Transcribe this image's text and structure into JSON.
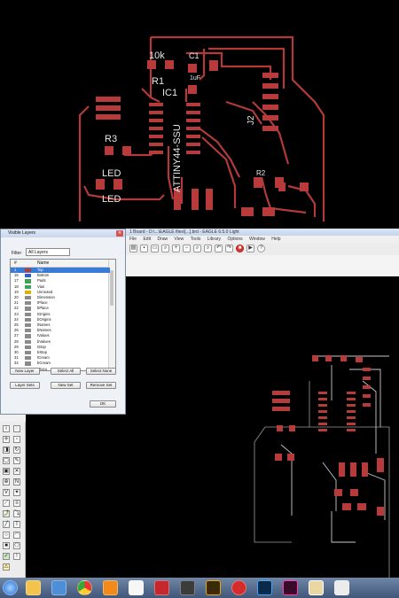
{
  "top_board": {
    "labels": {
      "r1_value": "10k",
      "r1": "R1",
      "ic1": "IC1",
      "c1": "C1",
      "c1_value": "1uF",
      "r3": "R3",
      "j2": "J2",
      "r2": "R2",
      "led_1": "LED",
      "led_2": "LED",
      "ic_part": "ATTINY44-SSU"
    },
    "colors": {
      "trace": "#b23a3a",
      "pad": "#b83b3b",
      "background": "#000000",
      "text": "#e8e8e8"
    }
  },
  "eagle_window": {
    "title": "1 Board - D:\\...\\EAGLE files\\[...].brd - EAGLE 6.5.0 Light",
    "menu": [
      "File",
      "Edit",
      "Draw",
      "View",
      "Tools",
      "Library",
      "Options",
      "Window",
      "Help"
    ],
    "toolbar_icons": [
      "open-icon",
      "save-icon",
      "print-icon",
      "cam-icon",
      "board-icon",
      "zoom-fit-icon",
      "zoom-in-icon",
      "zoom-out-icon",
      "zoom-redraw-icon",
      "zoom-select-icon",
      "undo-icon",
      "redo-icon",
      "stop-icon",
      "go-icon",
      "help-icon"
    ]
  },
  "layers_dialog": {
    "title": "Visible Layers",
    "filter_label": "Filter",
    "filter_value": "All Layers",
    "col_num": "#",
    "col_name": "Name",
    "layers": [
      {
        "num": "1",
        "name": "Top",
        "color": "#c0392b",
        "selected": true
      },
      {
        "num": "16",
        "name": "Bottom",
        "color": "#2e5bd8",
        "selected": false
      },
      {
        "num": "17",
        "name": "Pads",
        "color": "#3aa655",
        "selected": false
      },
      {
        "num": "18",
        "name": "Vias",
        "color": "#3aa655",
        "selected": false
      },
      {
        "num": "19",
        "name": "Unrouted",
        "color": "#d6b300",
        "selected": false
      },
      {
        "num": "20",
        "name": "Dimension",
        "color": "#8a8a8a",
        "selected": false
      },
      {
        "num": "21",
        "name": "tPlace",
        "color": "#8a8a8a",
        "selected": false
      },
      {
        "num": "22",
        "name": "bPlace",
        "color": "#8a8a8a",
        "selected": false
      },
      {
        "num": "23",
        "name": "tOrigins",
        "color": "#8a8a8a",
        "selected": false
      },
      {
        "num": "24",
        "name": "bOrigins",
        "color": "#8a8a8a",
        "selected": false
      },
      {
        "num": "25",
        "name": "tNames",
        "color": "#8a8a8a",
        "selected": false
      },
      {
        "num": "26",
        "name": "bNames",
        "color": "#8a8a8a",
        "selected": false
      },
      {
        "num": "27",
        "name": "tValues",
        "color": "#8a8a8a",
        "selected": false
      },
      {
        "num": "28",
        "name": "bValues",
        "color": "#8a8a8a",
        "selected": false
      },
      {
        "num": "29",
        "name": "tStop",
        "color": "#8a8a8a",
        "selected": false
      },
      {
        "num": "30",
        "name": "bStop",
        "color": "#8a8a8a",
        "selected": false
      },
      {
        "num": "31",
        "name": "tCream",
        "color": "#8a8a8a",
        "selected": false
      },
      {
        "num": "32",
        "name": "bCream",
        "color": "#8a8a8a",
        "selected": false
      },
      {
        "num": "51",
        "name": "tDocu",
        "color": "#8a8a8a",
        "selected": false
      },
      {
        "num": "52",
        "name": "bDocu",
        "color": "#8a8a8a",
        "selected": false
      }
    ],
    "buttons": {
      "new_layer": "New Layer",
      "select_all": "Select All",
      "select_none": "Select None",
      "layer_sets": "Layer Sets",
      "new_set": "New Set",
      "remove_set": "Remove Set",
      "ok": "OK"
    }
  },
  "left_toolbar_icons": [
    "info-icon",
    "show-icon",
    "display-icon",
    "mark-icon",
    "move-icon",
    "copy-icon",
    "mirror-icon",
    "rotate-icon",
    "group-icon",
    "change-icon",
    "paste-icon",
    "delete-icon",
    "add-icon",
    "name-icon",
    "value-icon",
    "smash-icon",
    "split-icon",
    "optimize-icon",
    "route-icon",
    "ripup-icon",
    "wire-icon",
    "text-icon",
    "circle-icon",
    "arc-icon",
    "rect-icon",
    "polygon-icon",
    "via-icon",
    "hole-icon",
    "drc-icon",
    "errors-icon",
    "warning-icon"
  ],
  "taskbar": {
    "icons": [
      "start-orb-icon",
      "explorer-icon",
      "folder-icon",
      "chrome-icon",
      "vlc-icon",
      "pdf-icon",
      "acrobat-icon",
      "media-icon",
      "illustrator-icon",
      "opera-icon",
      "photoshop-icon",
      "indesign-icon",
      "eagle-icon",
      "paint-icon"
    ]
  }
}
